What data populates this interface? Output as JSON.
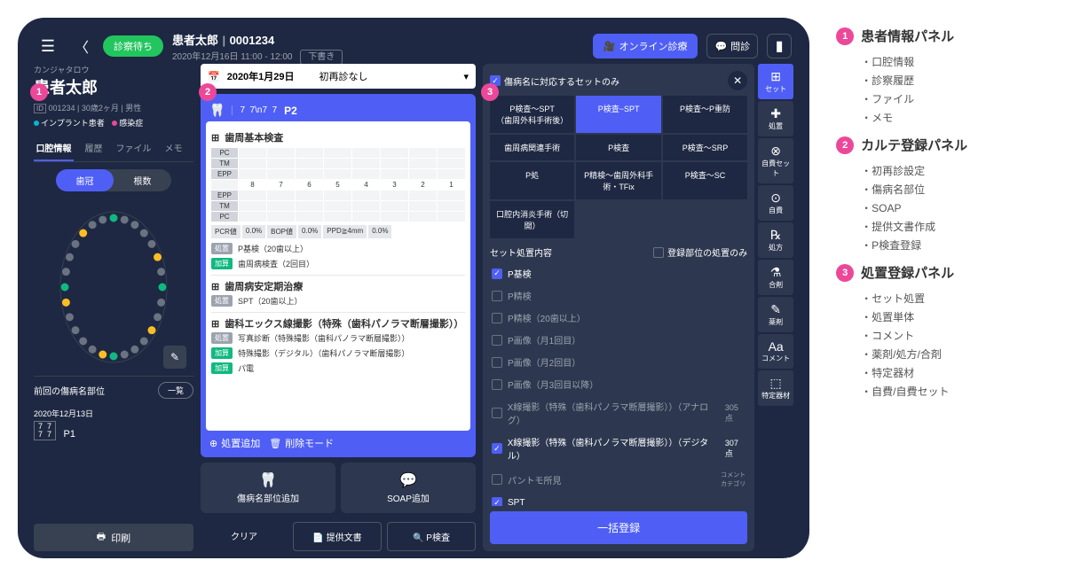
{
  "topbar": {
    "status": "診察待ち",
    "patient_name": "患者太郎",
    "patient_id": "0001234",
    "datetime": "2020年12月16日  11:00 - 12:00",
    "draft": "下書き",
    "online": "オンライン診療",
    "monshin": "問診"
  },
  "patient": {
    "kana": "カンジャタロウ",
    "name": "患者太郎",
    "meta": "001234 | 30歳2ヶ月 | 男性",
    "tag1": "インプラント患者",
    "tag2": "感染症",
    "tag1_color": "#06b6d4",
    "tag2_color": "#ec4899"
  },
  "tabs1": [
    "口腔情報",
    "履歴",
    "ファイル",
    "メモ"
  ],
  "seg": [
    "歯冠",
    "根数"
  ],
  "prev": {
    "label": "前回の傷病名部位",
    "list": "一覧",
    "date": "2020年12月13日",
    "code": "P1",
    "fdi": "7  7\n7  7"
  },
  "print": "印刷",
  "chart": {
    "date": "2020年1月29日",
    "revisit": "初再診なし",
    "code": "P2",
    "sections": {
      "s1": "歯周基本検査",
      "s2": "歯周病安定期治療",
      "s3": "歯科エックス線撮影（特殊（歯科パノラマ断層撮影））"
    },
    "row_labels": [
      "PC",
      "TM",
      "EPP",
      "EPP",
      "TM",
      "PC"
    ],
    "nums": [
      "8",
      "7",
      "6",
      "5",
      "4",
      "3",
      "2",
      "1"
    ],
    "stats": {
      "pcr": "PCR値",
      "pcr_v": "0.0%",
      "bop": "BOP値",
      "bop_v": "0.0%",
      "ppd": "PPD≧4mm",
      "ppd_v": "0.0%"
    },
    "lines": {
      "l1": "P基検（20歯以上）",
      "l2": "歯周病検査（2回目）",
      "l3": "SPT（20歯以上）",
      "l4": "写真診断（特殊撮影（歯科パノラマ断層撮影））",
      "l5": "特殊撮影（デジタル）（歯科パノラマ断層撮影）",
      "l6": "パ電"
    },
    "badge_proc": "処置",
    "badge_add": "加算",
    "add_proc": "処置追加",
    "del_mode": "削除モード"
  },
  "btns2": {
    "b1": "傷病名部位追加",
    "b2": "SOAP追加",
    "clear": "クリア",
    "doc": "提供文書",
    "pcheck": "P検査"
  },
  "panel3": {
    "only_disease": "傷病名に対応するセットのみ",
    "grid": [
      "P検査～SPT\n（歯周外科手術後）",
      "P検査−SPT",
      "P検査～P重防",
      "歯周病関連手術",
      "P検査",
      "P検査～SRP",
      "P処",
      "P精検～歯周外科手術・TFix",
      "P検査～SC",
      "口腔内消炎手術（切開）",
      "",
      ""
    ],
    "sub": "セット処置内容",
    "only_reg": "登録部位の処置のみ",
    "items": [
      {
        "label": "P基検",
        "on": true
      },
      {
        "label": "P精検",
        "on": false
      },
      {
        "label": "P精検（20歯以上）",
        "on": false
      },
      {
        "label": "P画像（月1回目）",
        "on": false
      },
      {
        "label": "P画像（月2回目）",
        "on": false
      },
      {
        "label": "P画像（月3回目以降）",
        "on": false
      },
      {
        "label": "X線撮影（特殊（歯科パノラマ断層撮影））（アナログ）",
        "on": false,
        "pts": "305点"
      },
      {
        "label": "X線撮影（特殊（歯科パノラマ断層撮影））（デジタル）",
        "on": true,
        "pts": "307点"
      },
      {
        "label": "パントモ所見",
        "on": false,
        "note": "コメント\nカテゴリ"
      },
      {
        "label": "SPT",
        "on": true
      }
    ],
    "bulk": "一括登録"
  },
  "side": [
    {
      "ico": "⊞",
      "label": "セット",
      "sel": true
    },
    {
      "ico": "✚",
      "label": "処置"
    },
    {
      "ico": "⊗",
      "label": "自費セット"
    },
    {
      "ico": "⊙",
      "label": "自費"
    },
    {
      "ico": "℞",
      "label": "処方"
    },
    {
      "ico": "⚗",
      "label": "合剤"
    },
    {
      "ico": "✎",
      "label": "薬剤"
    },
    {
      "ico": "Aa",
      "label": "コメント"
    },
    {
      "ico": "⬚",
      "label": "特定器材"
    }
  ],
  "legend": [
    {
      "num": "1",
      "title": "患者情報パネル",
      "items": [
        "口腔情報",
        "診察履歴",
        "ファイル",
        "メモ"
      ]
    },
    {
      "num": "2",
      "title": "カルテ登録パネル",
      "items": [
        "初再診設定",
        "傷病名部位",
        "SOAP",
        "提供文書作成",
        "P検査登録"
      ]
    },
    {
      "num": "3",
      "title": "処置登録パネル",
      "items": [
        "セット処置",
        "処置単体",
        "コメント",
        "薬剤/処方/合剤",
        "特定器材",
        "自費/自費セット"
      ]
    }
  ]
}
